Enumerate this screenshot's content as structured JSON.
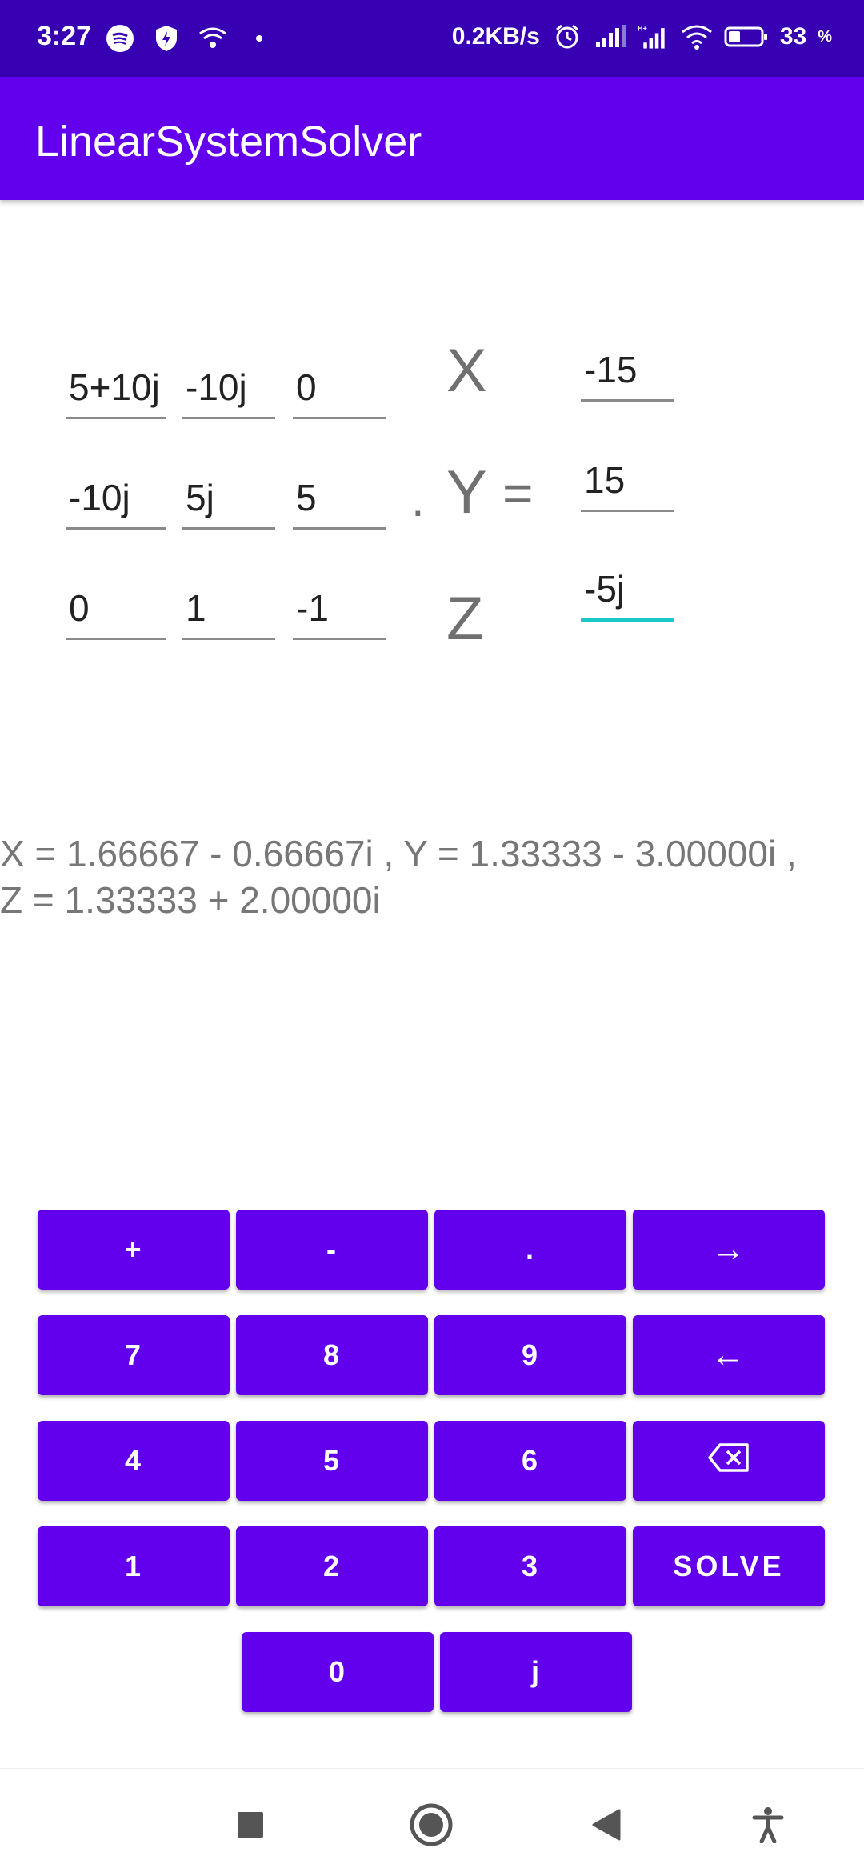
{
  "status_bar": {
    "time": "3:27",
    "net_speed": "0.2KB/s",
    "battery": "33",
    "battery_unit": "%",
    "icons": [
      "spotify-icon",
      "shield-icon",
      "wifi-call-icon",
      "dot-icon",
      "alarm-icon",
      "signal-icon",
      "signal-hplus-icon",
      "wifi-icon",
      "battery-icon"
    ]
  },
  "app_bar": {
    "title": "LinearSystemSolver"
  },
  "matrix": {
    "r0": [
      "5+10j",
      "-10j",
      "0"
    ],
    "r1": [
      "-10j",
      "5j",
      "5"
    ],
    "r2": [
      "0",
      "1",
      "-1"
    ]
  },
  "variables": {
    "x": "X",
    "y": "Y",
    "z": "Z",
    "dot": ".",
    "equals": "="
  },
  "rhs": [
    "-15",
    "15",
    "-5j"
  ],
  "result": {
    "line1": "X = 1.66667 - 0.66667i , Y = 1.33333 - 3.00000i ,",
    "line2": "Z = 1.33333 + 2.00000i"
  },
  "keypad": {
    "plus": "+",
    "minus": "-",
    "dot": ".",
    "right": "→",
    "k7": "7",
    "k8": "8",
    "k9": "9",
    "left": "←",
    "k4": "4",
    "k5": "5",
    "k6": "6",
    "backspace": "⌫",
    "k1": "1",
    "k2": "2",
    "k3": "3",
    "solve": "SOLVE",
    "k0": "0",
    "j": "j"
  },
  "colors": {
    "status_bar": "#3700b3",
    "app_bar": "#6200ee",
    "button": "#6200ee",
    "focus_underline": "#1bc8c8"
  }
}
